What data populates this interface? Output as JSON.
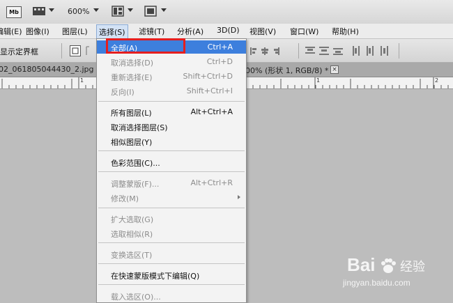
{
  "appbar": {
    "mb_label": "Mb",
    "zoom": "600%"
  },
  "menubar": {
    "items": [
      "编辑(E)",
      "图像(I)",
      "图层(L)",
      "选择(S)",
      "滤镜(T)",
      "分析(A)",
      "3D(D)",
      "视图(V)",
      "窗口(W)",
      "帮助(H)"
    ],
    "active_index": 3
  },
  "options": {
    "show_bounds_label": "显示定界框"
  },
  "tabs": {
    "left_doc": "02_061805044430_2.jpg",
    "right_doc": "00% (形状 1, RGB/8) *",
    "close_glyph": "×"
  },
  "ruler": {
    "labels": [
      "1",
      "1",
      "2"
    ]
  },
  "dropdown": {
    "items": [
      {
        "label": "全部(A)",
        "shortcut": "Ctrl+A",
        "disabled": false,
        "highlighted": true
      },
      {
        "label": "取消选择(D)",
        "shortcut": "Ctrl+D",
        "disabled": true
      },
      {
        "label": "重新选择(E)",
        "shortcut": "Shift+Ctrl+D",
        "disabled": true
      },
      {
        "label": "反向(I)",
        "shortcut": "Shift+Ctrl+I",
        "disabled": true
      },
      {
        "label": "所有图层(L)",
        "shortcut": "Alt+Ctrl+A",
        "disabled": false
      },
      {
        "label": "取消选择图层(S)",
        "shortcut": "",
        "disabled": false
      },
      {
        "label": "相似图层(Y)",
        "shortcut": "",
        "disabled": false
      },
      {
        "label": "色彩范围(C)...",
        "shortcut": "",
        "disabled": false
      },
      {
        "label": "调整蒙版(F)...",
        "shortcut": "Alt+Ctrl+R",
        "disabled": true
      },
      {
        "label": "修改(M)",
        "shortcut": "",
        "disabled": true,
        "submenu": true
      },
      {
        "label": "扩大选取(G)",
        "shortcut": "",
        "disabled": true
      },
      {
        "label": "选取相似(R)",
        "shortcut": "",
        "disabled": true
      },
      {
        "label": "变换选区(T)",
        "shortcut": "",
        "disabled": true
      },
      {
        "label": "在快速蒙版模式下编辑(Q)",
        "shortcut": "",
        "disabled": false
      },
      {
        "label": "载入选区(O)...",
        "shortcut": "",
        "disabled": true
      }
    ]
  },
  "watermark": {
    "brand": "Bai",
    "brand_cn": "经验",
    "url": "jingyan.baidu.com"
  },
  "colors": {
    "highlight": "#3d7fdd",
    "callout": "#e51e1e"
  }
}
